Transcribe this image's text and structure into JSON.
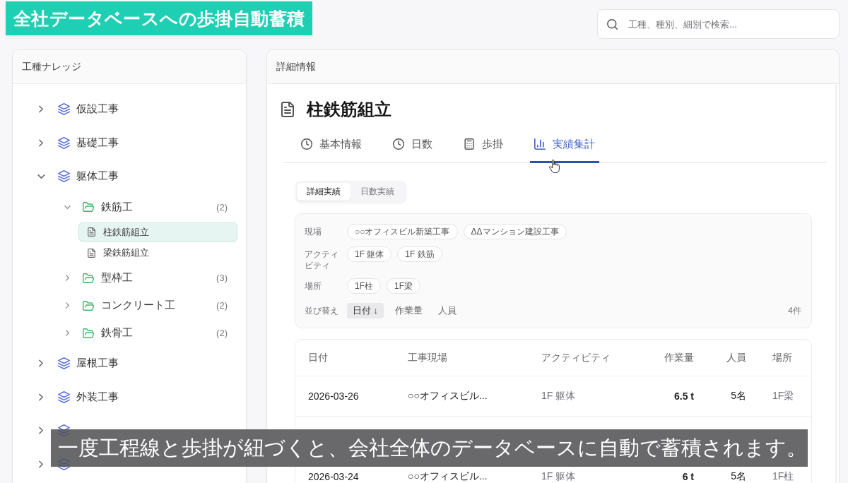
{
  "banner": {
    "title": "全社データベースへの歩掛自動蓄積"
  },
  "search": {
    "placeholder": "工種、種別、細別で検索..."
  },
  "tree": {
    "title": "工種ナレッジ",
    "items": [
      {
        "label": "仮設工事",
        "expanded": false
      },
      {
        "label": "基礎工事",
        "expanded": false
      },
      {
        "label": "躯体工事",
        "expanded": true,
        "children": [
          {
            "label": "鉄筋工",
            "count": "(2)",
            "expanded": true,
            "children": [
              {
                "label": "柱鉄筋組立",
                "selected": true
              },
              {
                "label": "梁鉄筋組立",
                "selected": false
              }
            ]
          },
          {
            "label": "型枠工",
            "count": "(3)",
            "expanded": false
          },
          {
            "label": "コンクリート工",
            "count": "(2)",
            "expanded": false
          },
          {
            "label": "鉄骨工",
            "count": "(2)",
            "expanded": false
          }
        ]
      },
      {
        "label": "屋根工事",
        "expanded": false
      },
      {
        "label": "外装工事",
        "expanded": false
      },
      {
        "expanded": false
      },
      {
        "expanded": false
      }
    ]
  },
  "detail": {
    "header": "詳細情報",
    "title": "柱鉄筋組立",
    "tabs": [
      {
        "kind": "info",
        "label": "基本情報",
        "selected": false
      },
      {
        "kind": "days",
        "label": "日数",
        "selected": false
      },
      {
        "kind": "rate",
        "label": "歩掛",
        "selected": false
      },
      {
        "kind": "summary",
        "label": "実績集計",
        "selected": true
      }
    ],
    "segments": [
      {
        "label": "詳細実績",
        "selected": true
      },
      {
        "label": "日数実績",
        "selected": false
      }
    ],
    "filters": [
      {
        "label": "現場",
        "chips": [
          "○○オフィスビル新築工事",
          "ΔΔマンション建設工事"
        ]
      },
      {
        "label": "アクティビティ",
        "chips": [
          "1F 躯体",
          "1F 鉄筋"
        ]
      },
      {
        "label": "場所",
        "chips": [
          "1F柱",
          "1F梁"
        ]
      }
    ],
    "sort": {
      "label": "並び替え",
      "options": [
        {
          "label": "日付 ↓",
          "selected": true
        },
        {
          "label": "作業量",
          "selected": false
        },
        {
          "label": "人員",
          "selected": false
        }
      ]
    },
    "result_count": "4件",
    "table": {
      "columns": [
        "日付",
        "工事現場",
        "アクティビティ",
        "作業量",
        "人員",
        "場所"
      ],
      "rows": [
        [
          "2026-03-26",
          "○○オフィスビル...",
          "1F 躯体",
          "6.5 t",
          "5名",
          "1F梁"
        ],
        [
          "2026-03-24",
          "○○オフィスビル...",
          "1F 躯体",
          "6 t",
          "5名",
          "1F柱"
        ]
      ]
    }
  },
  "caption": {
    "text": "一度工程線と歩掛が紐づくと、会社全体のデータベースに自動で蓄積されます。"
  }
}
